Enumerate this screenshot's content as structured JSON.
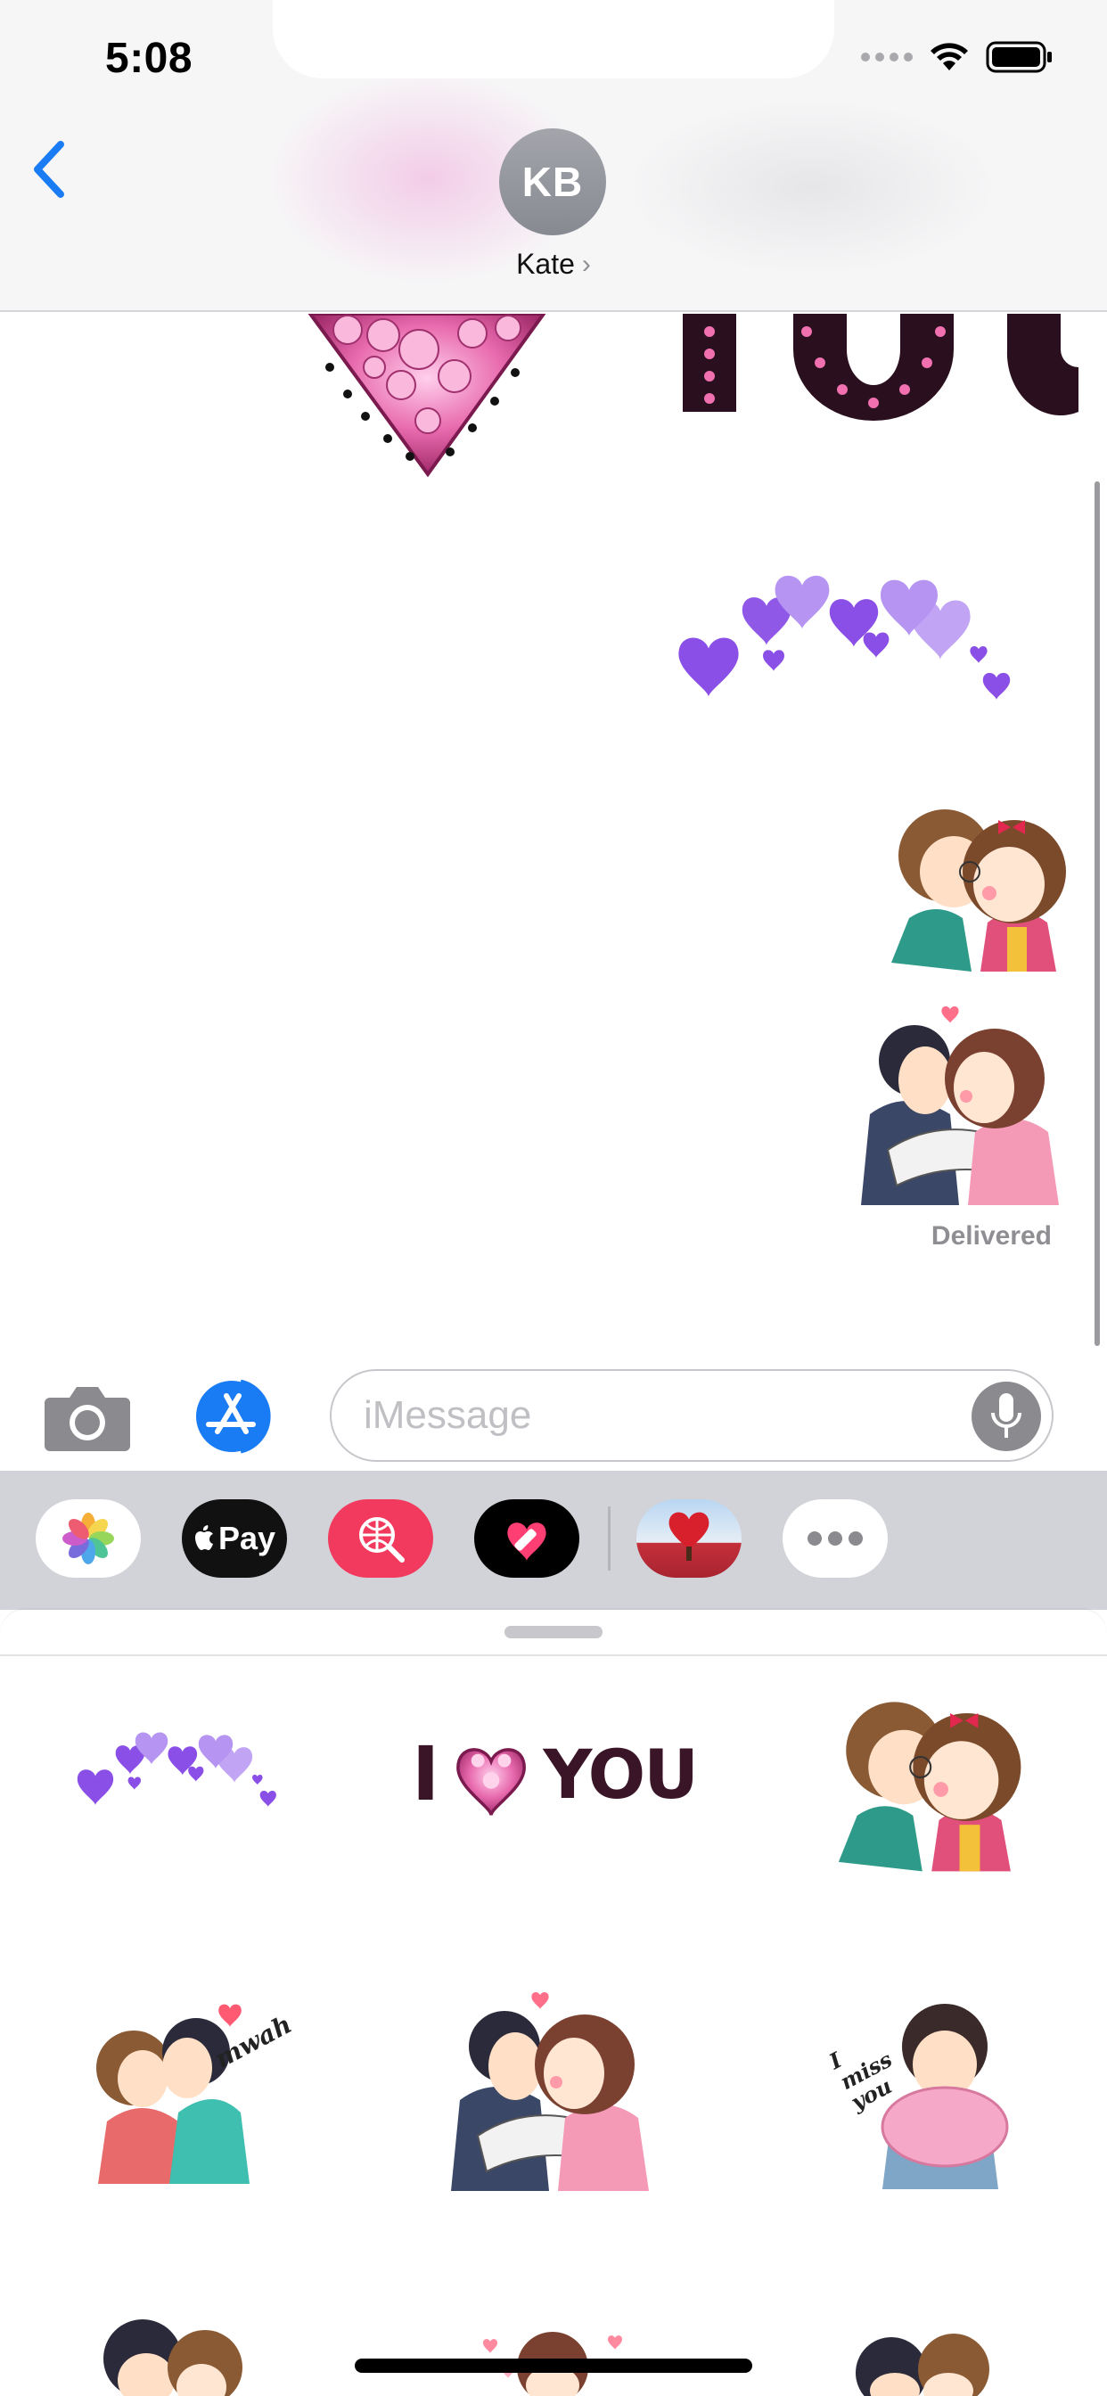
{
  "status_bar": {
    "time": "5:08",
    "icons": [
      "signal-icon",
      "wifi-icon",
      "battery-icon"
    ]
  },
  "header": {
    "back_icon": "chevron-left-icon",
    "avatar_initials": "KB",
    "contact_name": "Kate",
    "contact_chevron": "›"
  },
  "conversation": {
    "messages": [
      {
        "type": "sticker",
        "name": "i-love-you-jewel-sticker"
      },
      {
        "type": "sticker",
        "name": "purple-hearts-sticker"
      },
      {
        "type": "sticker",
        "name": "kissing-couple-sticker"
      },
      {
        "type": "sticker",
        "name": "hugging-couple-kiss-sticker"
      }
    ],
    "status": "Delivered"
  },
  "compose": {
    "placeholder": "iMessage",
    "value": ""
  },
  "app_strip": {
    "apps": [
      {
        "name": "photos-app-icon"
      },
      {
        "name": "apple-pay-app-icon",
        "label": "Pay"
      },
      {
        "name": "image-search-app-icon"
      },
      {
        "name": "heart-sticker-app-icon"
      },
      {
        "name": "heart-tree-app-icon"
      },
      {
        "name": "more-apps-icon"
      }
    ]
  },
  "sticker_drawer": {
    "stickers": [
      {
        "name": "purple-hearts-sticker"
      },
      {
        "name": "i-love-you-sticker",
        "text_left": "I",
        "text_right": "YOU"
      },
      {
        "name": "kissing-couple-sticker"
      },
      {
        "name": "mwah-couple-sticker",
        "caption": "mwah"
      },
      {
        "name": "hugging-couple-kiss-sticker"
      },
      {
        "name": "i-miss-you-sticker",
        "caption": "I miss you"
      }
    ]
  },
  "colors": {
    "accent_blue": "#1a7cf4",
    "purple_heart": "#8a4fe6",
    "pink": "#e0609a"
  }
}
